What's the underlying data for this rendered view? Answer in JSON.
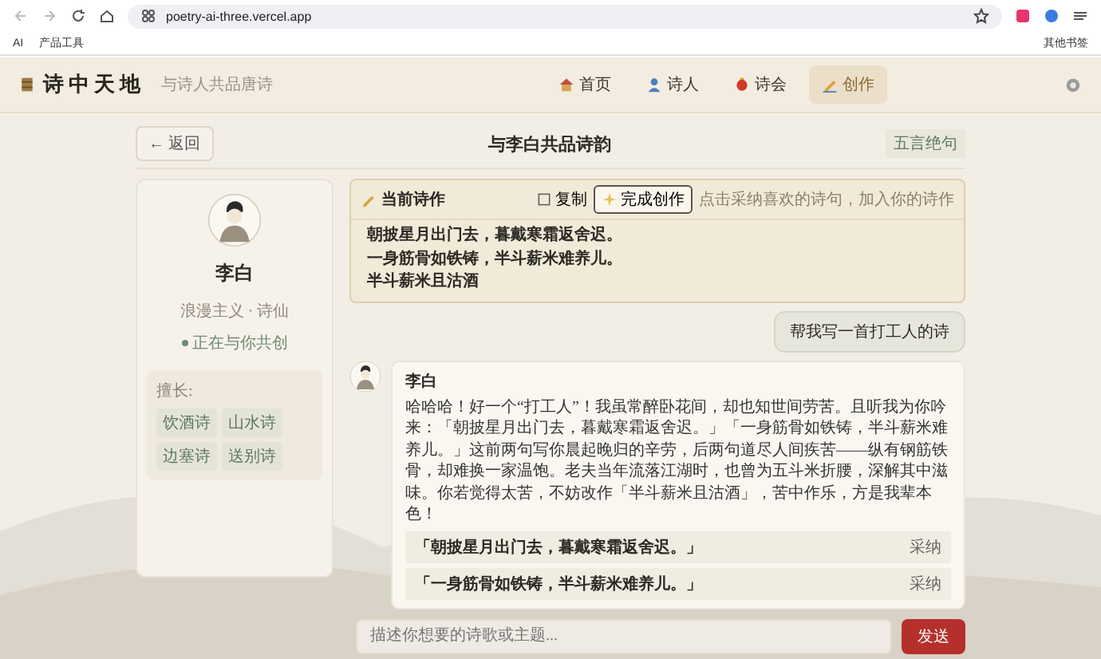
{
  "browser": {
    "url": "poetry-ai-three.vercel.app",
    "bookmarks": [
      "AI",
      "产品工具"
    ],
    "other_bookmarks": "其他书签"
  },
  "header": {
    "logo": "诗中天地",
    "tagline": "与诗人共品唐诗",
    "nav": [
      {
        "label": "首页",
        "selected": false,
        "kind": "home"
      },
      {
        "label": "诗人",
        "selected": false,
        "kind": "poet"
      },
      {
        "label": "诗会",
        "selected": false,
        "kind": "lantern"
      },
      {
        "label": "创作",
        "selected": true,
        "kind": "write"
      }
    ]
  },
  "page": {
    "back": "← 返回",
    "title": "与李白共品诗韵",
    "badge": "五言绝句"
  },
  "poet": {
    "name": "李白",
    "style": "浪漫主义 · 诗仙",
    "status": "正在与你共创",
    "specialties_label": "擅长:",
    "specialties": [
      "饮酒诗",
      "山水诗",
      "边塞诗",
      "送别诗"
    ]
  },
  "draft": {
    "title": "当前诗作",
    "copy": "复制",
    "finish": "完成创作",
    "hint": "点击采纳喜欢的诗句，加入你的诗作",
    "lines": [
      "朝披星月出门去，暮戴寒霜返舍迟。",
      "一身筋骨如铁铸，半斗薪米难养儿。",
      "半斗薪米且沽酒"
    ]
  },
  "messages": [
    {
      "kind": "user",
      "text": "帮我写一首打工人的诗"
    },
    {
      "kind": "poet",
      "name": "李白",
      "text": "哈哈哈！好一个“打工人”！我虽常醉卧花间，却也知世间劳苦。且听我为你吟来：「朝披星月出门去，暮戴寒霜返舍迟。」「一身筋骨如铁铸，半斗薪米难养儿。」这前两句写你晨起晚归的辛劳，后两句道尽人间疾苦——纵有钢筋铁骨，却难换一家温饱。老夫当年流落江湖时，也曾为五斗米折腰，深解其中滋味。你若觉得太苦，不妨改作「半斗薪米且沽酒」，苦中作乐，方是我辈本色！",
      "suggestions": [
        {
          "text": "「朝披星月出门去，暮戴寒霜返舍迟。」",
          "action": "采纳"
        },
        {
          "text": "「一身筋骨如铁铸，半斗薪米难养儿。」",
          "action": "采纳"
        }
      ]
    }
  ],
  "input": {
    "placeholder": "描述你想要的诗歌或主题...",
    "send": "发送"
  }
}
